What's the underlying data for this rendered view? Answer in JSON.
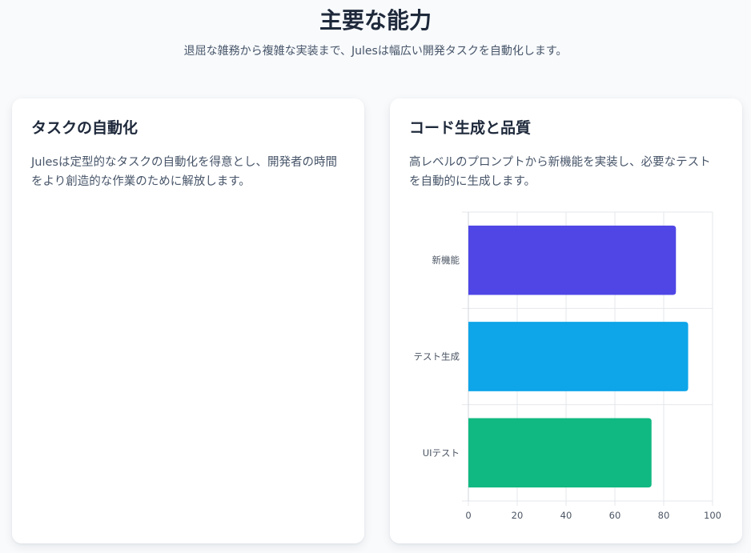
{
  "header": {
    "title": "主要な能力",
    "subtitle": "退屈な雑務から複雑な実装まで、Julesは幅広い開発タスクを自動化します。"
  },
  "cards": [
    {
      "title": "タスクの自動化",
      "description": "Julesは定型的なタスクの自動化を得意とし、開発者の時間をより創造的な作業のために解放します。"
    },
    {
      "title": "コード生成と品質",
      "description": "高レベルのプロンプトから新機能を実装し、必要なテストを自動的に生成します。"
    }
  ],
  "chart_data": {
    "type": "bar",
    "orientation": "horizontal",
    "categories": [
      "新機能",
      "テスト生成",
      "UIテスト"
    ],
    "values": [
      85,
      90,
      75
    ],
    "colors": [
      "#4f46e5",
      "#0ea5e9",
      "#10b981"
    ],
    "xlim": [
      0,
      100
    ],
    "xticks": [
      0,
      20,
      40,
      60,
      80,
      100
    ],
    "grid": true,
    "title": "",
    "xlabel": "",
    "ylabel": ""
  }
}
